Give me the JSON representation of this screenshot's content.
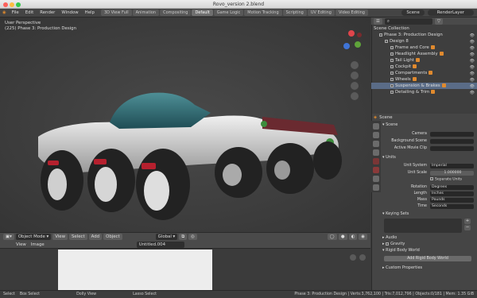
{
  "window": {
    "title": "Rovo_version 2.blend"
  },
  "menu": [
    "File",
    "Edit",
    "Render",
    "Window",
    "Help"
  ],
  "workspaces": [
    "3D View Full",
    "Animation",
    "Compositing",
    "Default",
    "Game Logic",
    "Motion Tracking",
    "Scripting",
    "UV Editing",
    "Video Editing"
  ],
  "active_workspace": "Default",
  "scene_field": "Scene",
  "renderlayer_field": "RenderLayer",
  "viewport": {
    "info_perspective": "User Perspective",
    "info_frame": "(225) Phase 3: Production Design"
  },
  "vp_header": {
    "mode": "Object Mode",
    "view": "View",
    "select": "Select",
    "add": "Add",
    "object": "Object",
    "orientation": "Global"
  },
  "image_editor": {
    "view": "View",
    "image": "Image",
    "image_name": "Untitled.004"
  },
  "statusbar": {
    "items": [
      "Select",
      "Box Select",
      "Dolly View",
      "Lasso Select"
    ],
    "stats": "Phase 3: Production Design | Verts:3,762,100 | Tris:7,012,796 | Objects:0/181 | Mem: 1.35 GiB"
  },
  "outliner": {
    "rows": [
      {
        "label": "Scene Collection",
        "indent": 0,
        "sel": false
      },
      {
        "label": "Phase 3: Production Design",
        "indent": 1,
        "sel": false
      },
      {
        "label": "Design 8",
        "indent": 2,
        "sel": false
      },
      {
        "label": "Frame and Core",
        "indent": 3,
        "sel": false
      },
      {
        "label": "Headlight Assembly",
        "indent": 3,
        "sel": false
      },
      {
        "label": "Tail Light",
        "indent": 3,
        "sel": false
      },
      {
        "label": "Cockpit",
        "indent": 3,
        "sel": false
      },
      {
        "label": "Compartments",
        "indent": 3,
        "sel": false
      },
      {
        "label": "Wheels",
        "indent": 3,
        "sel": false
      },
      {
        "label": "Suspension & Brakes",
        "indent": 3,
        "sel": true
      },
      {
        "label": "Detailing & Trim",
        "indent": 3,
        "sel": false
      }
    ]
  },
  "properties": {
    "breadcrumb": "Scene",
    "scene_section": "Scene",
    "camera_label": "Camera",
    "bg_scene_label": "Background Scene",
    "clip_label": "Active Movie Clip",
    "units_section": "Units",
    "unit_system_label": "Unit System",
    "unit_system_value": "Imperial",
    "unit_scale_label": "Unit Scale",
    "unit_scale_value": "1.000000",
    "separate_units": "Separate Units",
    "rotation_label": "Rotation",
    "rotation_value": "Degrees",
    "length_label": "Length",
    "length_value": "Inches",
    "mass_label": "Mass",
    "mass_value": "Pounds",
    "time_label": "Time",
    "time_value": "Seconds",
    "keying_sets": "Keying Sets",
    "audio": "Audio",
    "gravity": "Gravity",
    "rigid_body_world": "Rigid Body World",
    "add_rigid_body_world": "Add Rigid Body World",
    "custom_properties": "Custom Properties"
  }
}
